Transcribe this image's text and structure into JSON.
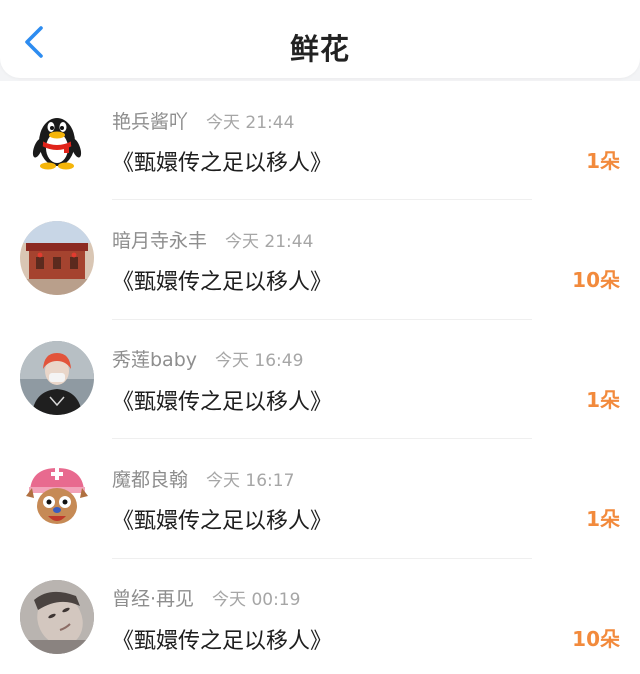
{
  "header": {
    "title": "鲜花",
    "back_icon": "chevron-left-icon",
    "accent_color": "#2d8cf0"
  },
  "list": {
    "count_color": "#f28a3c",
    "items": [
      {
        "name": "艳兵酱吖",
        "time": "今天 21:44",
        "book": "《甄嬛传之足以移人》",
        "count": "1朵",
        "avatar": "qq-penguin-avatar"
      },
      {
        "name": "暗月寺永丰",
        "time": "今天 21:44",
        "book": "《甄嬛传之足以移人》",
        "count": "10朵",
        "avatar": "building-photo-avatar"
      },
      {
        "name": "秀莲baby",
        "time": "今天 16:49",
        "book": "《甄嬛传之足以移人》",
        "count": "1朵",
        "avatar": "person-photo-avatar"
      },
      {
        "name": "魔都良翰",
        "time": "今天 16:17",
        "book": "《甄嬛传之足以移人》",
        "count": "1朵",
        "avatar": "cartoon-chopper-avatar"
      },
      {
        "name": "曾经·再见",
        "time": "今天 00:19",
        "book": "《甄嬛传之足以移人》",
        "count": "10朵",
        "avatar": "portrait-photo-avatar"
      }
    ]
  }
}
